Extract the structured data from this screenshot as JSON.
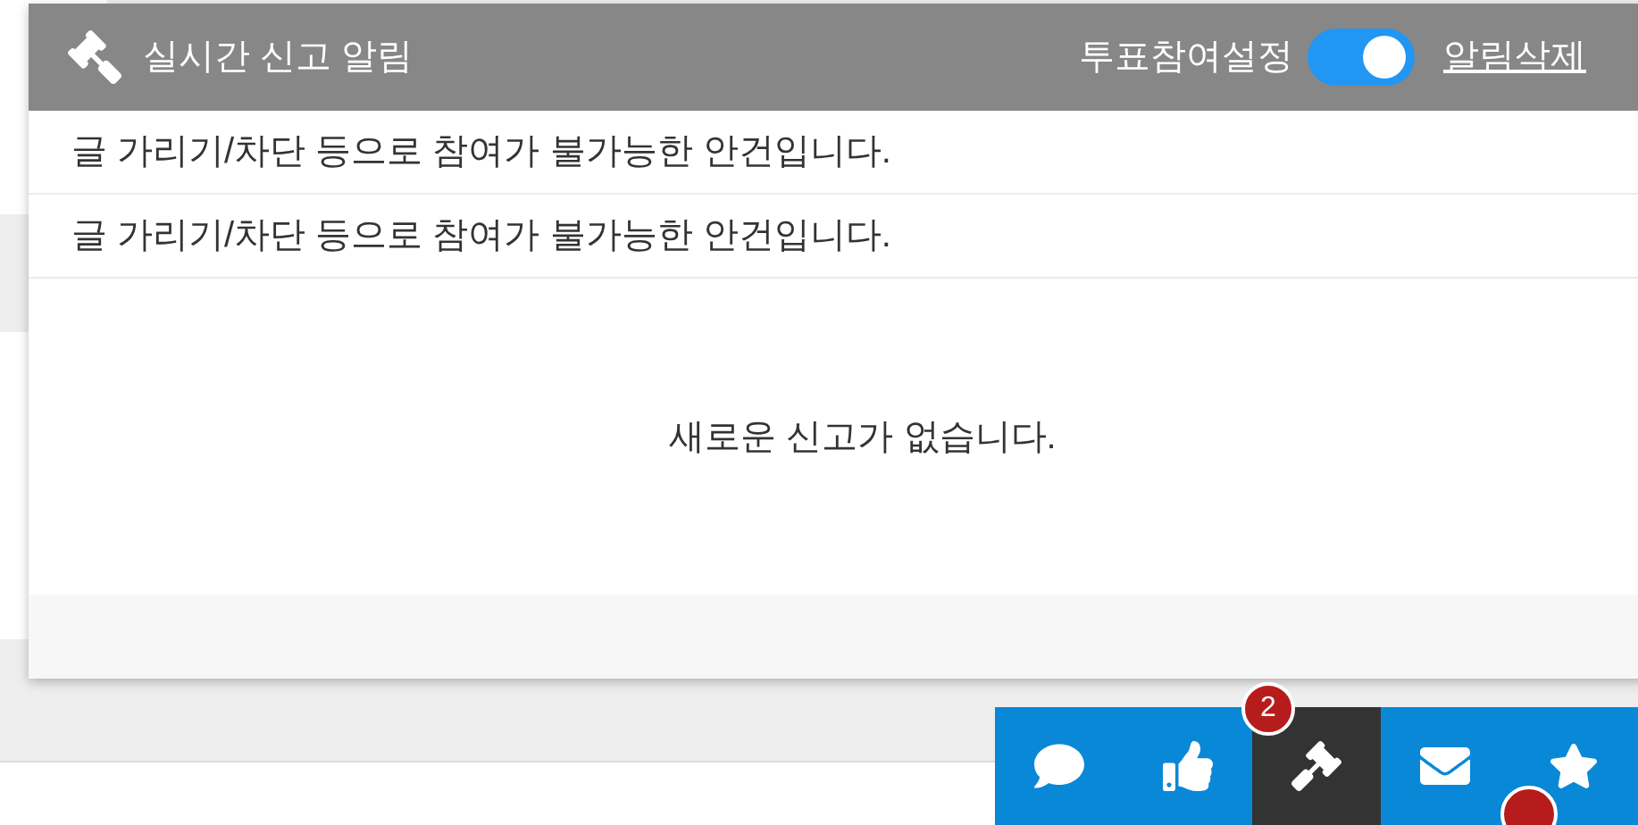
{
  "popup": {
    "title": "실시간 신고 알림",
    "toggle": {
      "label": "투표참여설정",
      "on": true
    },
    "delete_link": "알림삭제",
    "items": [
      "글 가리기/차단 등으로 참여가 불가능한 안건입니다.",
      "글 가리기/차단 등으로 참여가 불가능한 안건입니다."
    ],
    "empty_message": "새로운 신고가 없습니다."
  },
  "toolbar": [
    {
      "kind": "chat",
      "selected": false
    },
    {
      "kind": "like",
      "selected": false
    },
    {
      "kind": "gavel",
      "selected": true,
      "badge": "2"
    },
    {
      "kind": "mail",
      "selected": false
    },
    {
      "kind": "star",
      "selected": false
    }
  ]
}
